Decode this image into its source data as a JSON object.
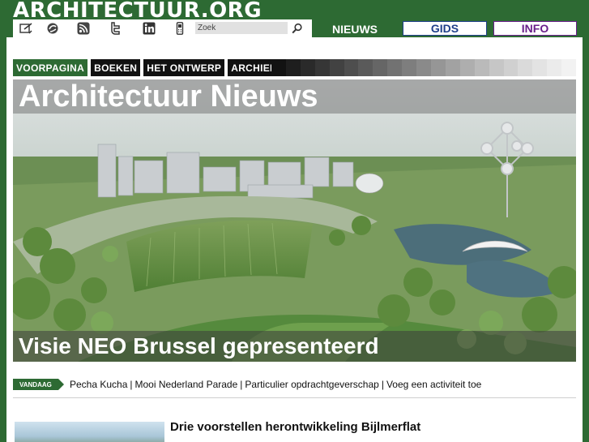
{
  "site": {
    "logo_text": "ARCHITECTUUR.ORG"
  },
  "toolbar": {
    "icons": [
      "compose-icon",
      "share-icon",
      "rss-icon",
      "twitter-icon",
      "linkedin-icon",
      "mobile-icon"
    ],
    "search_placeholder": "Zoek"
  },
  "nav": {
    "tabs": [
      {
        "label": "NIEUWS"
      },
      {
        "label": "GIDS"
      },
      {
        "label": "INFO"
      }
    ]
  },
  "subnav": {
    "items": [
      {
        "label": "VOORPAGINA"
      },
      {
        "label": "BOEKEN"
      },
      {
        "label": "HET ONTWERP"
      },
      {
        "label": "ARCHIEF"
      }
    ]
  },
  "hero": {
    "title": "Architectuur Nieuws",
    "caption": "Visie NEO Brussel gepresenteerd"
  },
  "vandaag": {
    "badge": "VANDAAG",
    "links": [
      {
        "label": "Pecha Kucha"
      },
      {
        "label": "Mooi Nederland Parade"
      },
      {
        "label": "Particulier opdrachtgeverschap"
      },
      {
        "label": "Voeg een activiteit toe"
      }
    ]
  },
  "article": {
    "title": "Drie voorstellen herontwikkeling Bijlmerflat"
  },
  "colors": {
    "brand_green": "#2d6a33",
    "gids_blue": "#1f3f8a",
    "info_purple": "#6a1f8a"
  }
}
